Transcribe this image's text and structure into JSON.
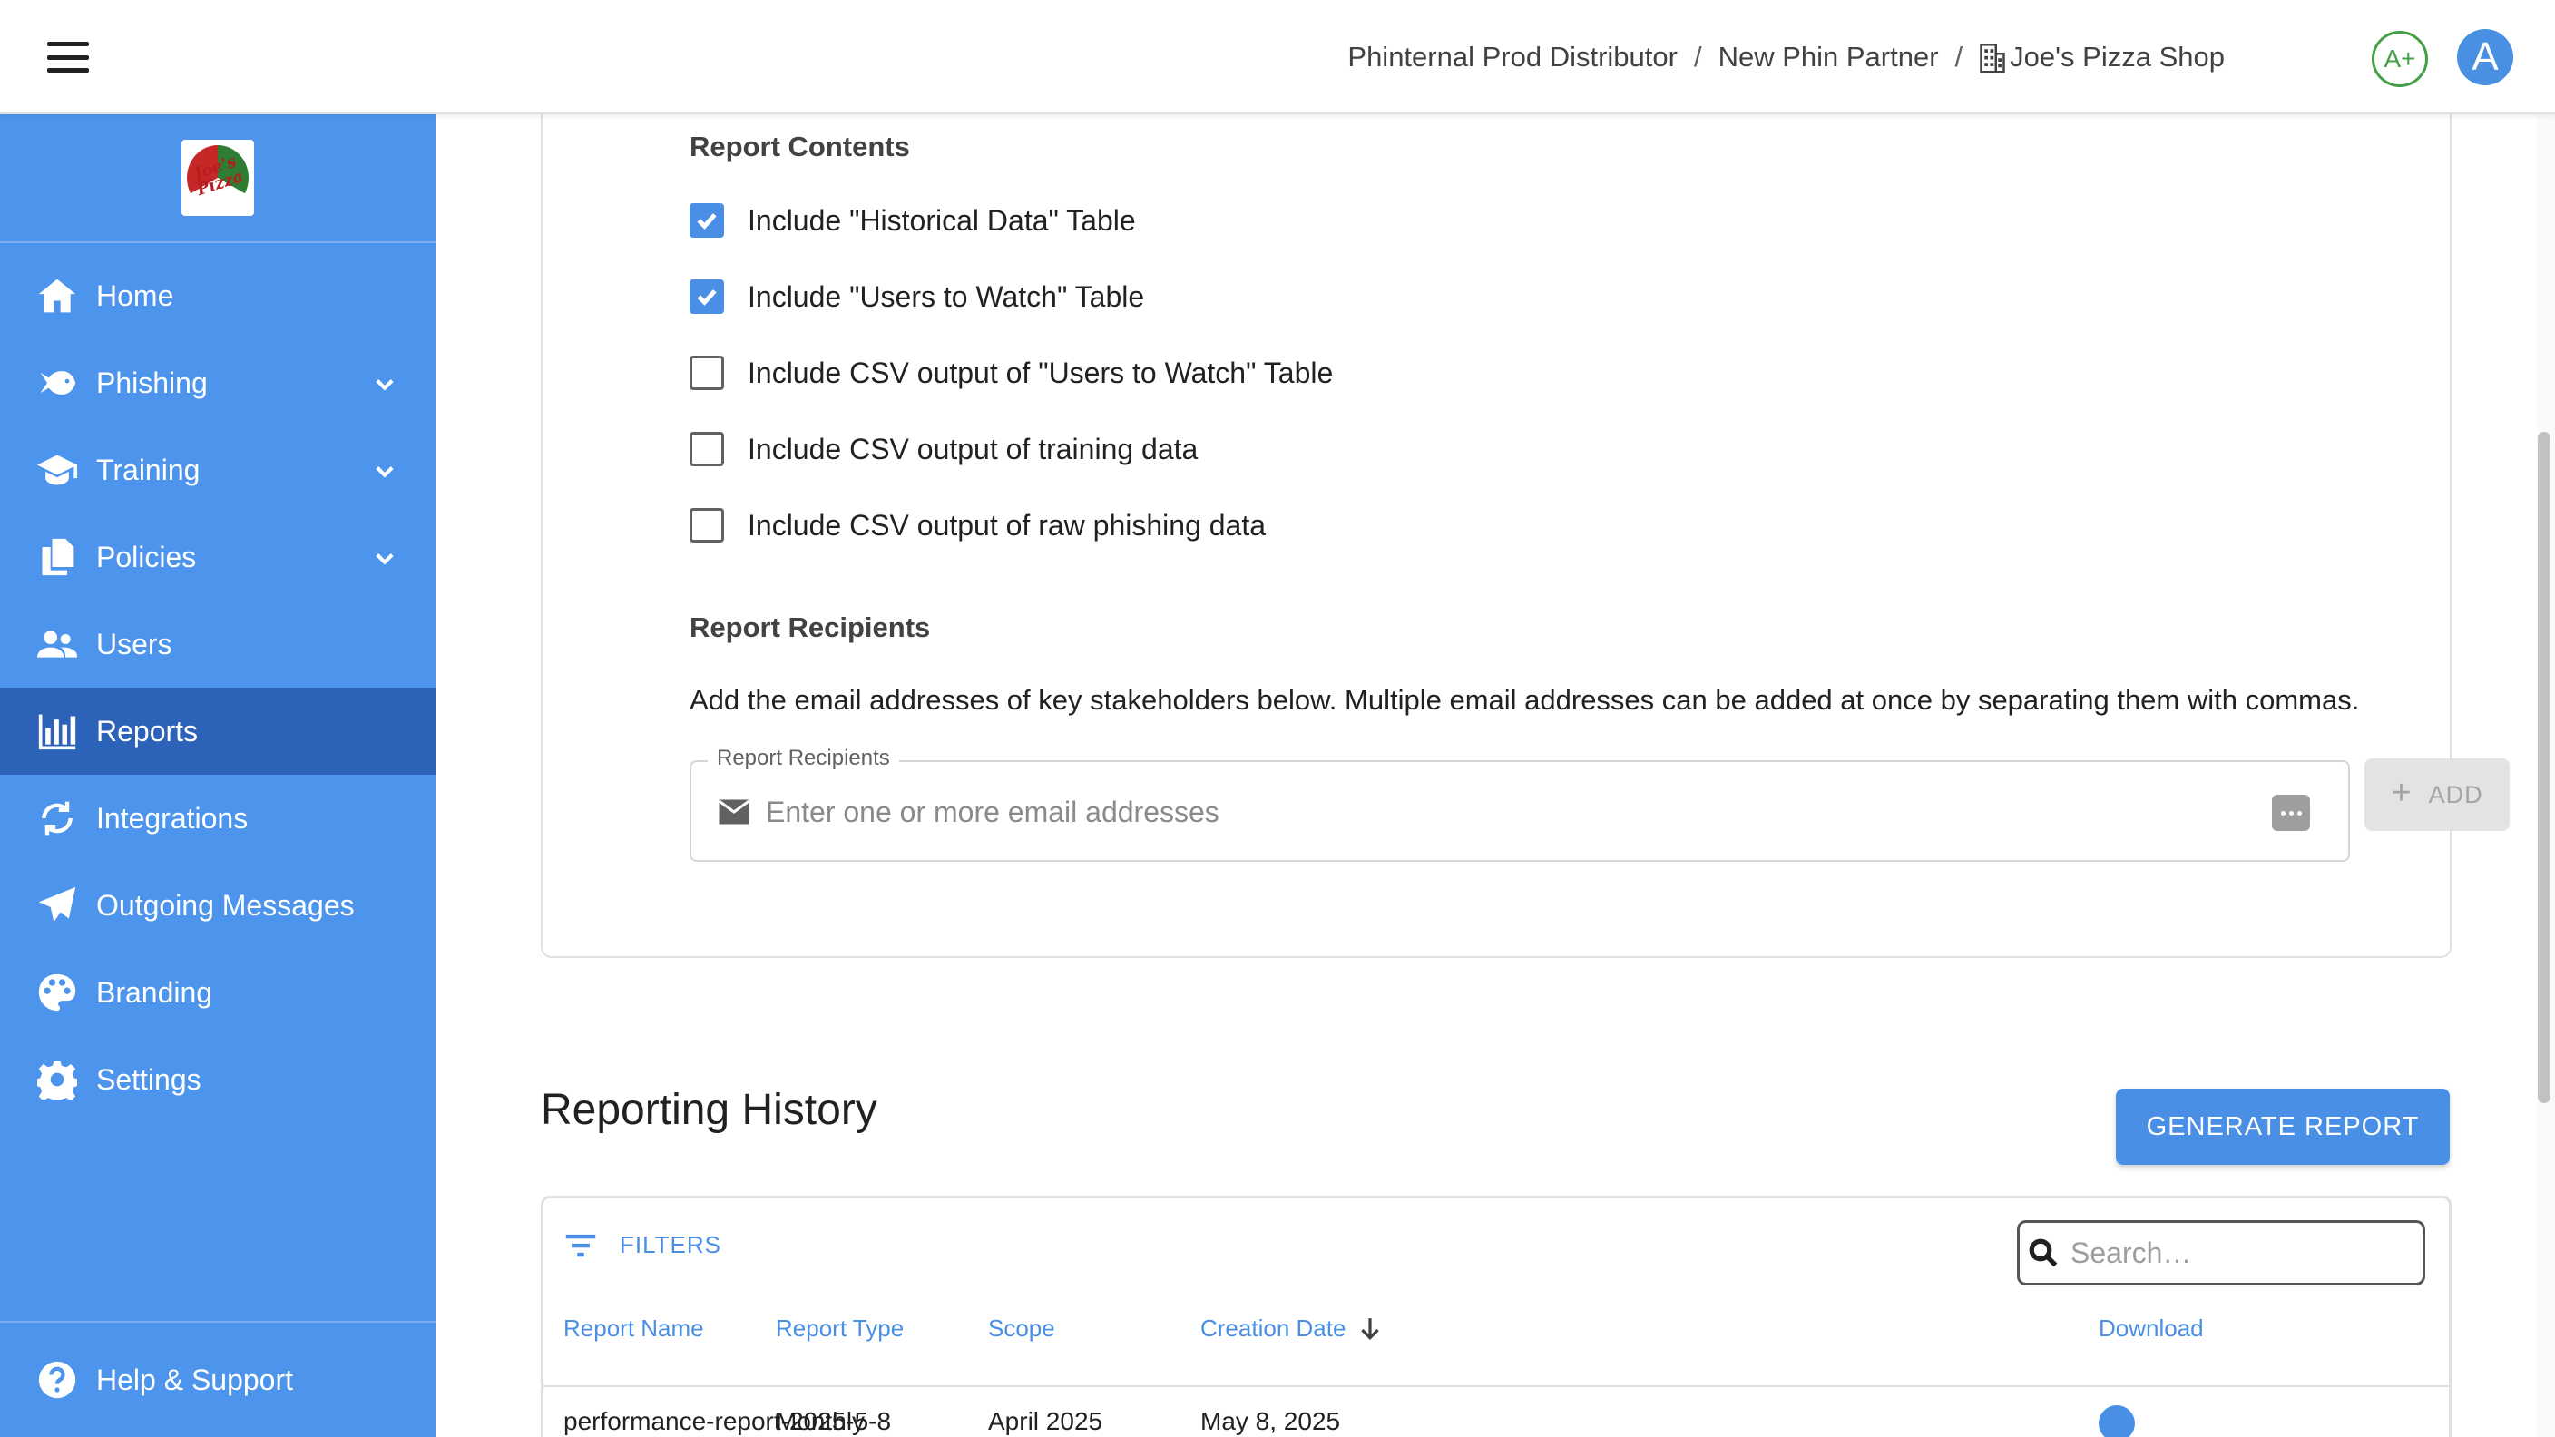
{
  "header": {
    "breadcrumb": [
      "Phinternal Prod Distributor",
      "New Phin Partner",
      "Joe's Pizza Shop"
    ],
    "separator": "/",
    "grade_badge": "A+",
    "avatar_letter": "A"
  },
  "sidebar": {
    "logo_text": "Joe's Pizza",
    "items": [
      {
        "label": "Home",
        "icon": "home-icon",
        "expandable": false,
        "active": false
      },
      {
        "label": "Phishing",
        "icon": "fish-icon",
        "expandable": true,
        "active": false
      },
      {
        "label": "Training",
        "icon": "graduation-cap-icon",
        "expandable": true,
        "active": false
      },
      {
        "label": "Policies",
        "icon": "documents-icon",
        "expandable": true,
        "active": false
      },
      {
        "label": "Users",
        "icon": "users-icon",
        "expandable": false,
        "active": false
      },
      {
        "label": "Reports",
        "icon": "bar-chart-icon",
        "expandable": false,
        "active": true
      },
      {
        "label": "Integrations",
        "icon": "sync-icon",
        "expandable": false,
        "active": false
      },
      {
        "label": "Outgoing Messages",
        "icon": "paper-plane-icon",
        "expandable": false,
        "active": false
      },
      {
        "label": "Branding",
        "icon": "palette-icon",
        "expandable": false,
        "active": false
      },
      {
        "label": "Settings",
        "icon": "gear-icon",
        "expandable": false,
        "active": false
      }
    ],
    "help_label": "Help & Support"
  },
  "report_contents": {
    "title": "Report Contents",
    "options": [
      {
        "label": "Include \"Historical Data\" Table",
        "checked": true
      },
      {
        "label": "Include \"Users to Watch\" Table",
        "checked": true
      },
      {
        "label": "Include CSV output of \"Users to Watch\" Table",
        "checked": false
      },
      {
        "label": "Include CSV output of training data",
        "checked": false
      },
      {
        "label": "Include CSV output of raw phishing data",
        "checked": false
      }
    ]
  },
  "report_recipients": {
    "title": "Report Recipients",
    "description": "Add the email addresses of key stakeholders below. Multiple email addresses can be added at once by separating them with commas.",
    "field_label": "Report Recipients",
    "placeholder": "Enter one or more email addresses",
    "value": "",
    "add_label": "ADD"
  },
  "reporting_history": {
    "title": "Reporting History",
    "generate_label": "GENERATE REPORT",
    "filters_label": "FILTERS",
    "search_placeholder": "Search…",
    "columns": [
      "Report Name",
      "Report Type",
      "Scope",
      "Creation Date",
      "Download"
    ],
    "sorted_column": "Creation Date",
    "rows": [
      {
        "name": "performance-report-2025-5-8",
        "type": "Monthly",
        "scope": "April 2025",
        "date": "May 8, 2025"
      }
    ]
  },
  "colors": {
    "sidebar_bg": "#4d95ec",
    "sidebar_active": "#2d62b9",
    "accent": "#4a8fe6",
    "grade_green": "#43a047"
  }
}
